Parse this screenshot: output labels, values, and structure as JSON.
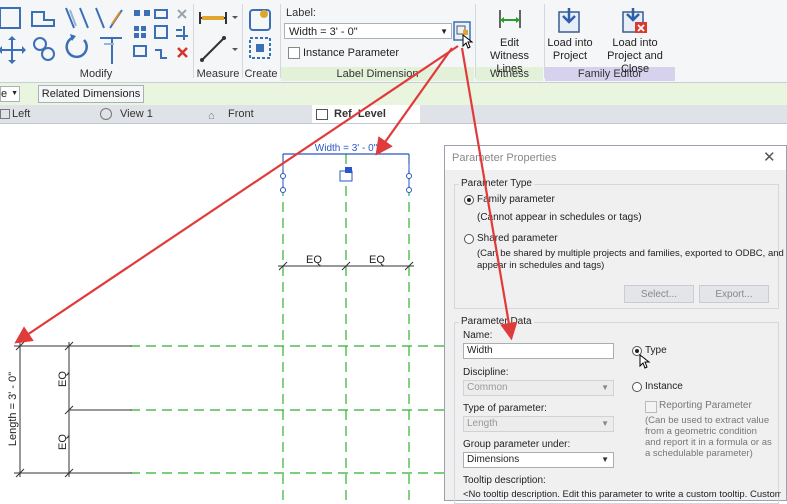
{
  "ribbon": {
    "panels": {
      "modify": "Modify",
      "measure": "Measure",
      "create": "Create",
      "label_dimension": "Label Dimension",
      "witness_lines": "Witness Lines",
      "family_editor": "Family Editor"
    },
    "measure_label": "Measure",
    "create_label": "Create",
    "label_caption": "Label:",
    "label_value": "Width = 3' - 0\"",
    "instance_parameter": "Instance Parameter",
    "edit_witness_lines": [
      "Edit",
      "Witness Lines"
    ],
    "load_into_project": [
      "Load into",
      "Project"
    ],
    "load_into_project_close": [
      "Load into",
      "Project and Close"
    ],
    "colors": {
      "green_panel": "#e3f1d8",
      "purple_panel": "#d6d2ee"
    }
  },
  "options_bar": {
    "left_fragment": "e",
    "related_dimensions": "Related Dimensions"
  },
  "view_tabs": [
    {
      "label": "Left"
    },
    {
      "label": "View 1"
    },
    {
      "label": "Front"
    },
    {
      "label": "Ref. Level"
    }
  ],
  "drawing": {
    "width_dimension": "Width = 3' - 0\"",
    "eq_labels": [
      "EQ",
      "EQ",
      "EQ",
      "EQ"
    ],
    "length_dimension": "Length = 3' - 0\"",
    "colors": {
      "ref_plane": "#2fb12f",
      "dimension": "#2a56c6",
      "arrow": "#e03b3b"
    }
  },
  "dialog": {
    "title": "Parameter Properties",
    "parameter_type_group": "Parameter Type",
    "family_parameter": "Family parameter",
    "family_parameter_note": "(Cannot appear in schedules or tags)",
    "shared_parameter": "Shared parameter",
    "shared_parameter_note_1": "(Can be shared by multiple projects and families, exported to ODBC, and",
    "shared_parameter_note_2": "appear in schedules and tags)",
    "select_button": "Select...",
    "export_button": "Export...",
    "parameter_data_group": "Parameter Data",
    "name_label": "Name:",
    "name_value": "Width",
    "type_radio": "Type",
    "instance_radio": "Instance",
    "discipline_label": "Discipline:",
    "discipline_value": "Common",
    "reporting_parameter": "Reporting Parameter",
    "reporting_note": [
      "(Can be used to extract value",
      "from a geometric condition",
      "and report it in a formula or as",
      "a schedulable parameter)"
    ],
    "type_of_parameter_label": "Type of parameter:",
    "type_of_parameter_value": "Length",
    "group_under_label": "Group parameter under:",
    "group_under_value": "Dimensions",
    "tooltip_label": "Tooltip description:",
    "tooltip_value": "<No tooltip description. Edit this parameter to write a custom tooltip. Custom"
  }
}
